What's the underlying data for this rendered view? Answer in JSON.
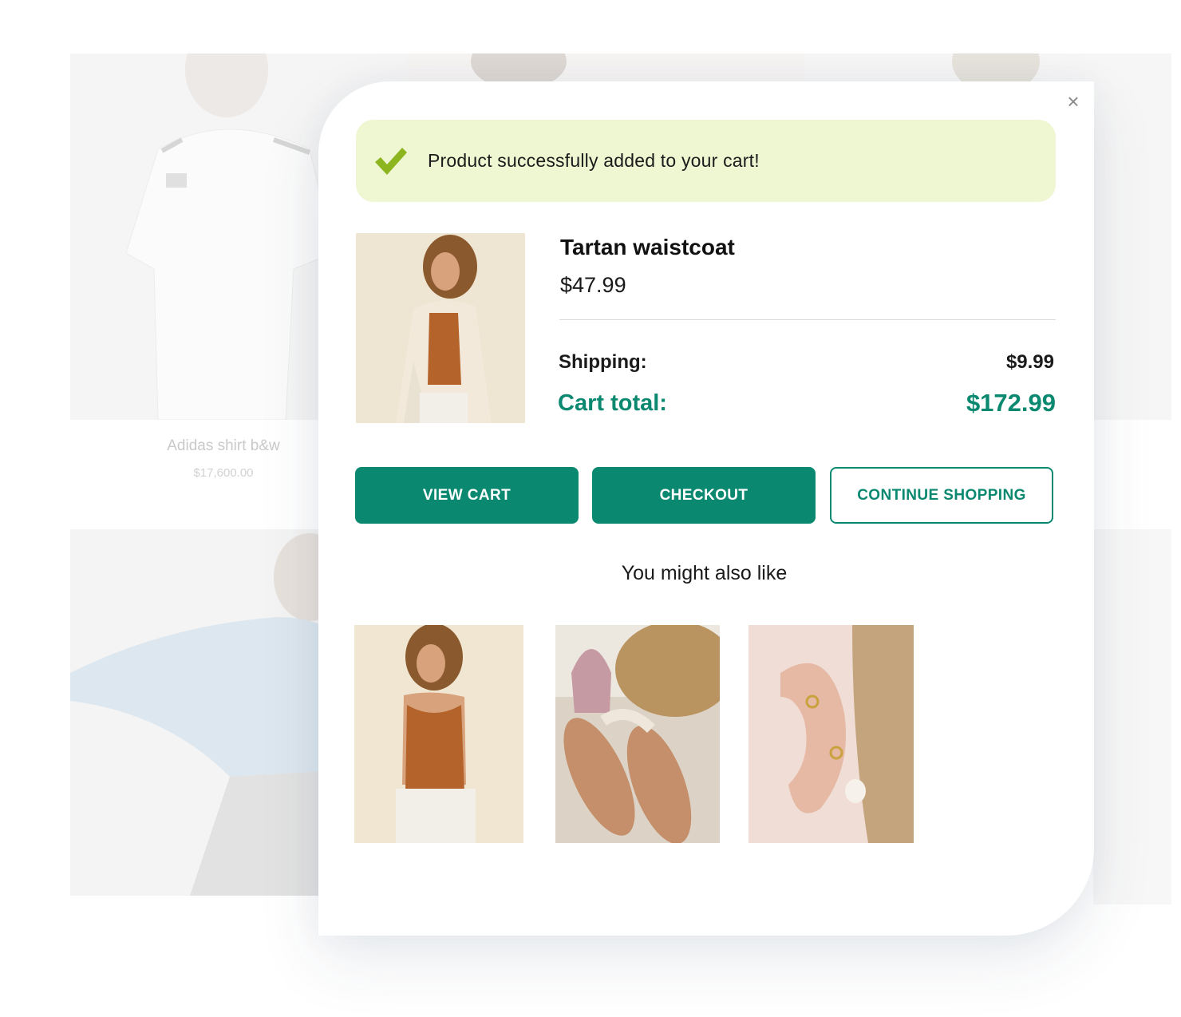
{
  "background": {
    "products": [
      {
        "name": "Adidas shirt b&w",
        "price": "$17,600.00"
      }
    ]
  },
  "modal": {
    "close_glyph": "×",
    "success": {
      "icon": "checkmark-icon",
      "text": "Product successfully added to your cart!",
      "icon_color": "#8cb520",
      "bg_color": "#eff6d2"
    },
    "product": {
      "title": "Tartan waistcoat",
      "price": "$47.99"
    },
    "summary": {
      "shipping_label": "Shipping:",
      "shipping_value": "$9.99",
      "total_label": "Cart total:",
      "total_value": "$172.99"
    },
    "buttons": {
      "view_cart": "VIEW CART",
      "checkout": "CHECKOUT",
      "continue": "CONTINUE SHOPPING"
    },
    "recommendations_title": "You might also like",
    "accent_color": "#0b8870"
  }
}
